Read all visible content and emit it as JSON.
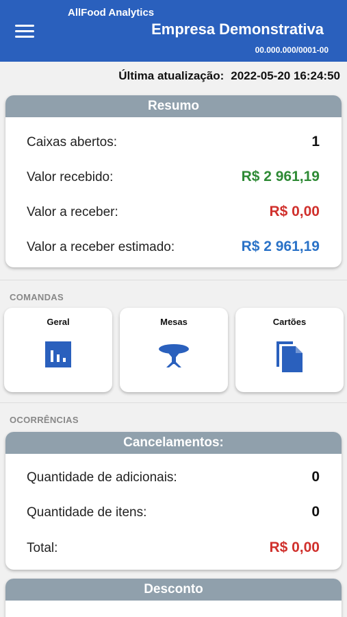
{
  "header": {
    "app_name": "AllFood Analytics",
    "company_name": "Empresa Demonstrativa",
    "cnpj": "00.000.000/0001-00"
  },
  "last_update": {
    "label": "Última atualização:",
    "value": "2022-05-20 16:24:50"
  },
  "resumo": {
    "title": "Resumo",
    "rows": [
      {
        "label": "Caixas abertos:",
        "value": "1",
        "color": "#111111"
      },
      {
        "label": "Valor recebido:",
        "value": "R$ 2 961,19",
        "color": "#2e8a35"
      },
      {
        "label": "Valor a receber:",
        "value": "R$ 0,00",
        "color": "#d0302c"
      },
      {
        "label": "Valor a receber estimado:",
        "value": "R$ 2 961,19",
        "color": "#2a72c7"
      }
    ]
  },
  "comandas": {
    "section_label": "COMANDAS",
    "tiles": [
      {
        "label": "Geral",
        "icon": "bar-chart-icon"
      },
      {
        "label": "Mesas",
        "icon": "table-icon"
      },
      {
        "label": "Cartões",
        "icon": "cards-icon"
      }
    ]
  },
  "ocorrencias": {
    "section_label": "OCORRÊNCIAS",
    "cancelamentos": {
      "title": "Cancelamentos:",
      "rows": [
        {
          "label": "Quantidade de adicionais:",
          "value": "0",
          "color": "#111111"
        },
        {
          "label": "Quantidade de itens:",
          "value": "0",
          "color": "#111111"
        },
        {
          "label": "Total:",
          "value": "R$ 0,00",
          "color": "#d0302c"
        }
      ]
    },
    "desconto": {
      "title": "Desconto"
    }
  },
  "colors": {
    "primary": "#2a60bd",
    "card_header": "#90a0ac",
    "icon": "#2a60bd"
  }
}
